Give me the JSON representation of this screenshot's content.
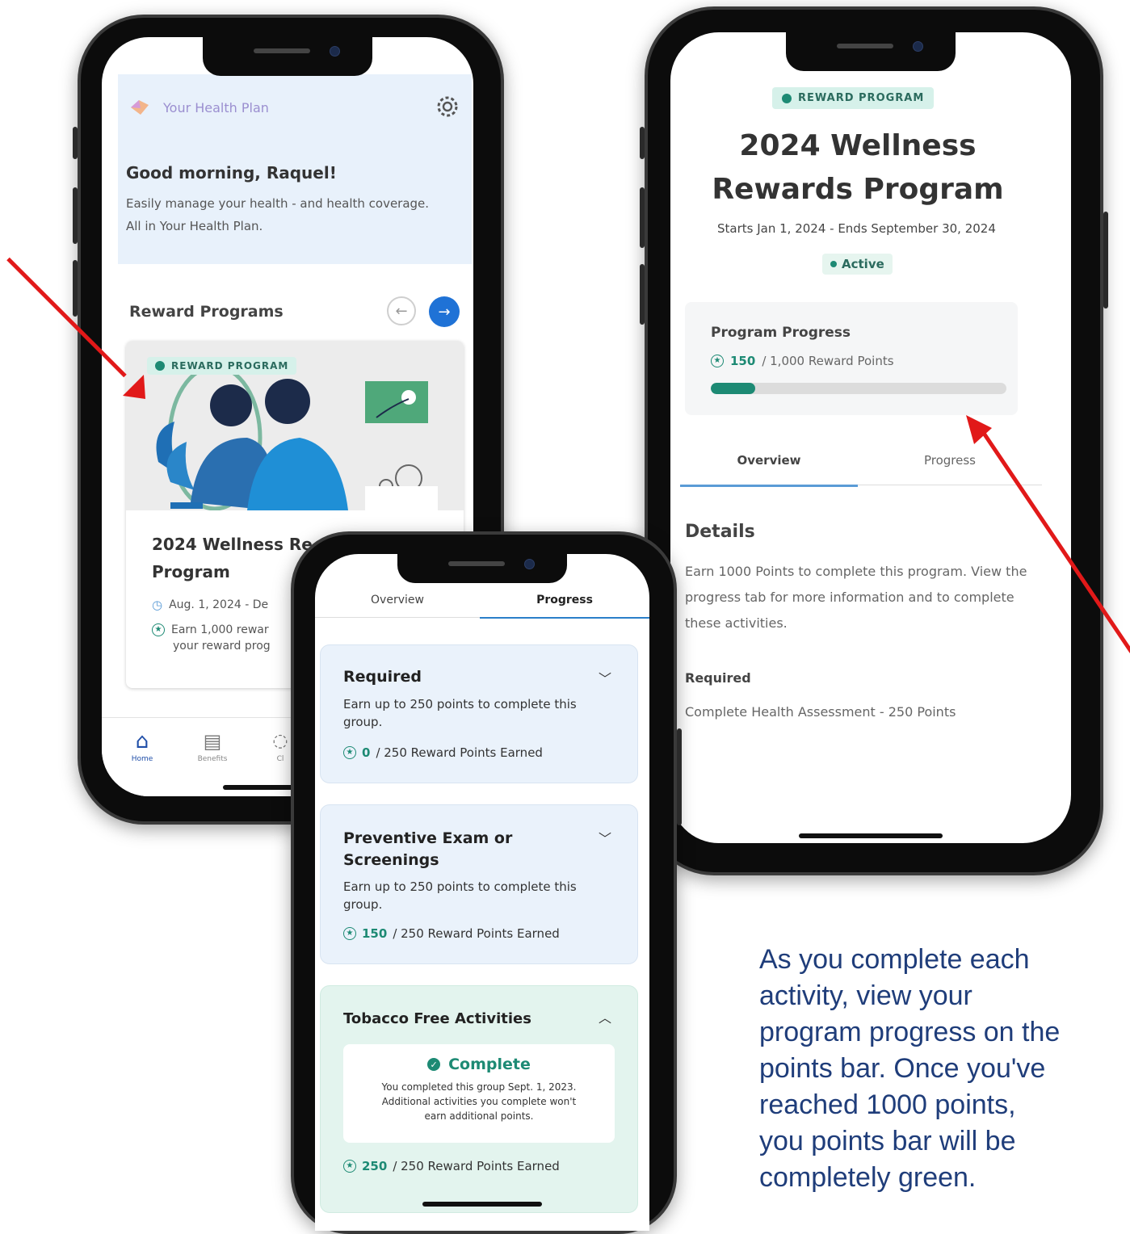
{
  "phone1": {
    "app_name": "Your Health Plan",
    "greeting": "Good morning, Raquel!",
    "subtitle": "Easily manage your health - and health coverage. All in Your Health Plan.",
    "section_title": "Reward Programs",
    "card": {
      "badge": "REWARD PROGRAM",
      "title": "2024 Wellness Re",
      "title2": "Program",
      "date": "Aug. 1, 2024 - De",
      "desc1": "Earn 1,000 rewar",
      "desc2": "your reward prog"
    },
    "nav": [
      "Home",
      "Benefits",
      "Cl"
    ]
  },
  "phone2": {
    "tabs": [
      "Overview",
      "Progress"
    ],
    "groups": [
      {
        "title": "Required",
        "desc": "Earn up to 250 points to complete this group.",
        "earned": "0",
        "total": "/ 250 Reward Points Earned"
      },
      {
        "title": "Preventive Exam or Screenings",
        "desc": "Earn up to 250 points to complete this group.",
        "earned": "150",
        "total": "/ 250 Reward Points Earned"
      },
      {
        "title": "Tobacco Free Activities",
        "complete_label": "Complete",
        "complete_note": "You completed this group Sept. 1, 2023. Additional activities you complete won't earn additional points.",
        "earned": "250",
        "total": "/ 250 Reward Points Earned"
      }
    ]
  },
  "phone3": {
    "badge": "REWARD PROGRAM",
    "title_line1": "2024 Wellness",
    "title_line2": "Rewards Program",
    "dates": "Starts Jan 1, 2024  - Ends September 30, 2024",
    "status": "Active",
    "progress_title": "Program Progress",
    "points_earned": "150",
    "points_total": "/ 1,000 Reward Points",
    "progress_fraction": 0.15,
    "tabs": [
      "Overview",
      "Progress"
    ],
    "details_title": "Details",
    "details_text": "Earn 1000 Points to complete this program. View the progress tab for more information and to complete these activities.",
    "required_title": "Required",
    "required_item": "Complete Health Assessment - 250 Points"
  },
  "caption": "As you complete each activity, view your program progress on the points bar. Once you've reached 1000 points, you points bar will be completely green.",
  "colors": {
    "accent_green": "#1d8a74",
    "badge_bg": "#d6f1ea",
    "arrow_red": "#e11919",
    "caption_blue": "#1f3d7a",
    "blue_button": "#1f72d6"
  }
}
